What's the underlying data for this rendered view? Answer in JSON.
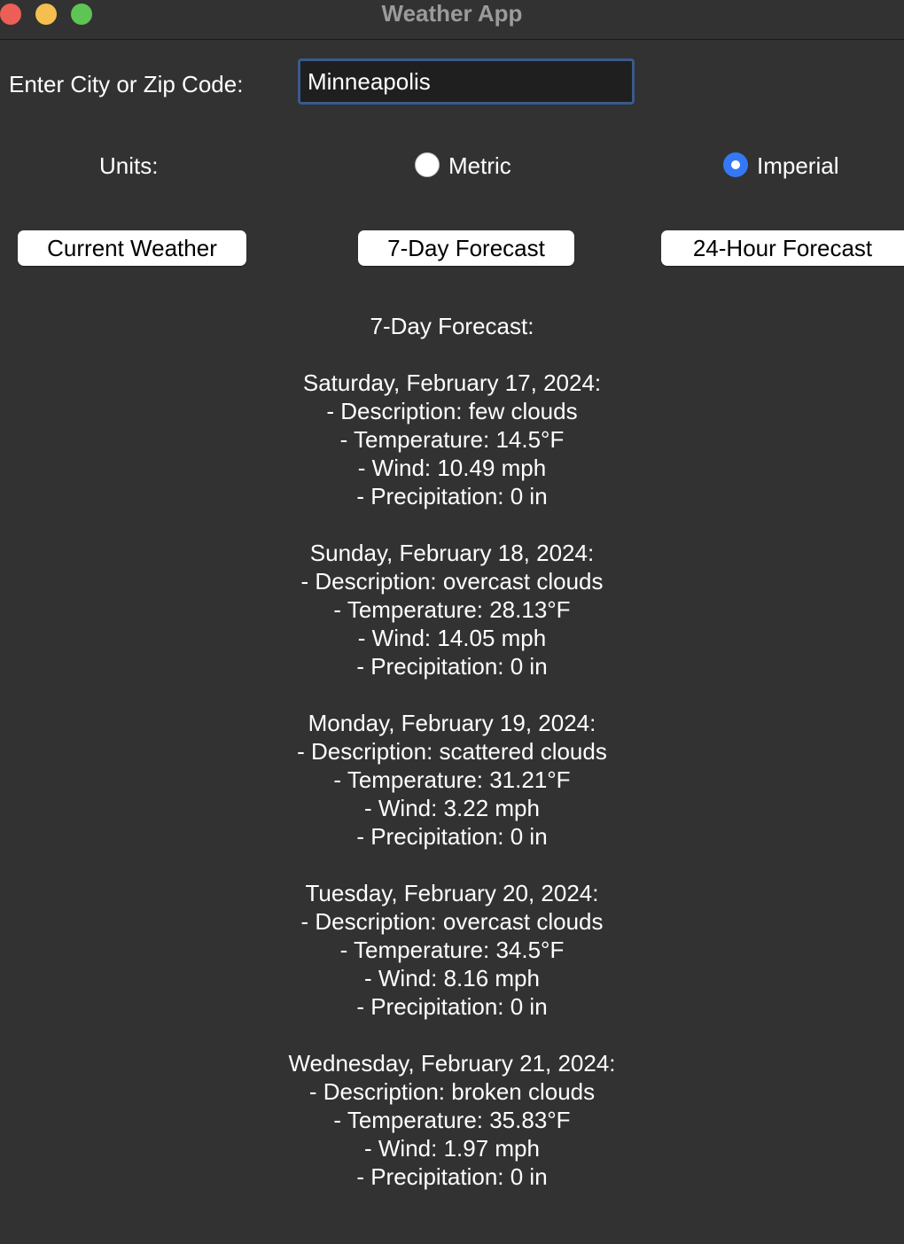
{
  "window": {
    "title": "Weather App"
  },
  "city": {
    "label": "Enter City or Zip Code:",
    "value": "Minneapolis"
  },
  "units": {
    "label": "Units:",
    "options": [
      "Metric",
      "Imperial"
    ],
    "selected": "Imperial"
  },
  "buttons": {
    "current": "Current Weather",
    "seven_day": "7-Day Forecast",
    "hourly": "24-Hour Forecast"
  },
  "output": {
    "heading": "7-Day Forecast:",
    "days": [
      {
        "date": "Saturday, February 17, 2024:",
        "description": "- Description: few clouds",
        "temperature": "- Temperature: 14.5°F",
        "wind": "- Wind: 10.49 mph",
        "precipitation": "- Precipitation: 0 in"
      },
      {
        "date": "Sunday, February 18, 2024:",
        "description": "- Description: overcast clouds",
        "temperature": "- Temperature: 28.13°F",
        "wind": "- Wind: 14.05 mph",
        "precipitation": "- Precipitation: 0 in"
      },
      {
        "date": "Monday, February 19, 2024:",
        "description": "- Description: scattered clouds",
        "temperature": "- Temperature: 31.21°F",
        "wind": "- Wind: 3.22 mph",
        "precipitation": "- Precipitation: 0 in"
      },
      {
        "date": "Tuesday, February 20, 2024:",
        "description": "- Description: overcast clouds",
        "temperature": "- Temperature: 34.5°F",
        "wind": "- Wind: 8.16 mph",
        "precipitation": "- Precipitation: 0 in"
      },
      {
        "date": "Wednesday, February 21, 2024:",
        "description": "- Description: broken clouds",
        "temperature": "- Temperature: 35.83°F",
        "wind": "- Wind: 1.97 mph",
        "precipitation": "- Precipitation: 0 in"
      }
    ]
  },
  "colors": {
    "background": "#323232",
    "accent": "#3478f6",
    "close": "#ec5f56",
    "minimize": "#f4bf4f",
    "maximize": "#5ec453"
  }
}
